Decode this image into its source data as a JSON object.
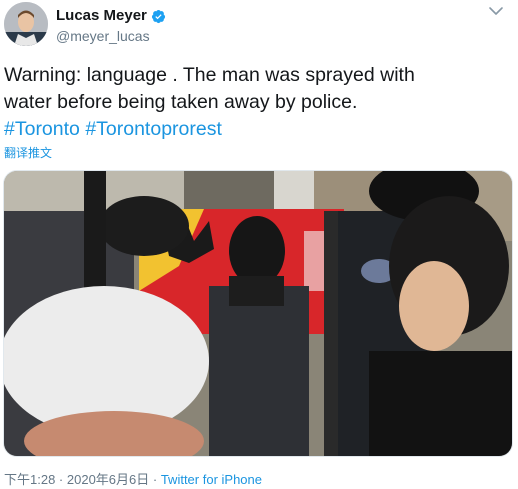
{
  "author": {
    "display_name": "Lucas Meyer",
    "handle": "@meyer_lucas",
    "verified": true
  },
  "tweet": {
    "text_line1": "Warning: language . The man was sprayed with",
    "text_line2": "water before being taken away by police.",
    "hashtag1": "#Toronto",
    "hashtag2": "#Torontoprorest",
    "translate_label": "翻译推文"
  },
  "meta": {
    "time": "下午1:28",
    "separator1": " · ",
    "date": "2020年6月6日",
    "separator2": " · ",
    "source": "Twitter for iPhone"
  },
  "colors": {
    "link": "#1b95e0",
    "secondary_text": "#657786",
    "primary_text": "#14171a",
    "verified_badge": "#1da1f2"
  },
  "icons": {
    "verified": "verified-badge-icon",
    "more": "chevron-down-icon"
  }
}
